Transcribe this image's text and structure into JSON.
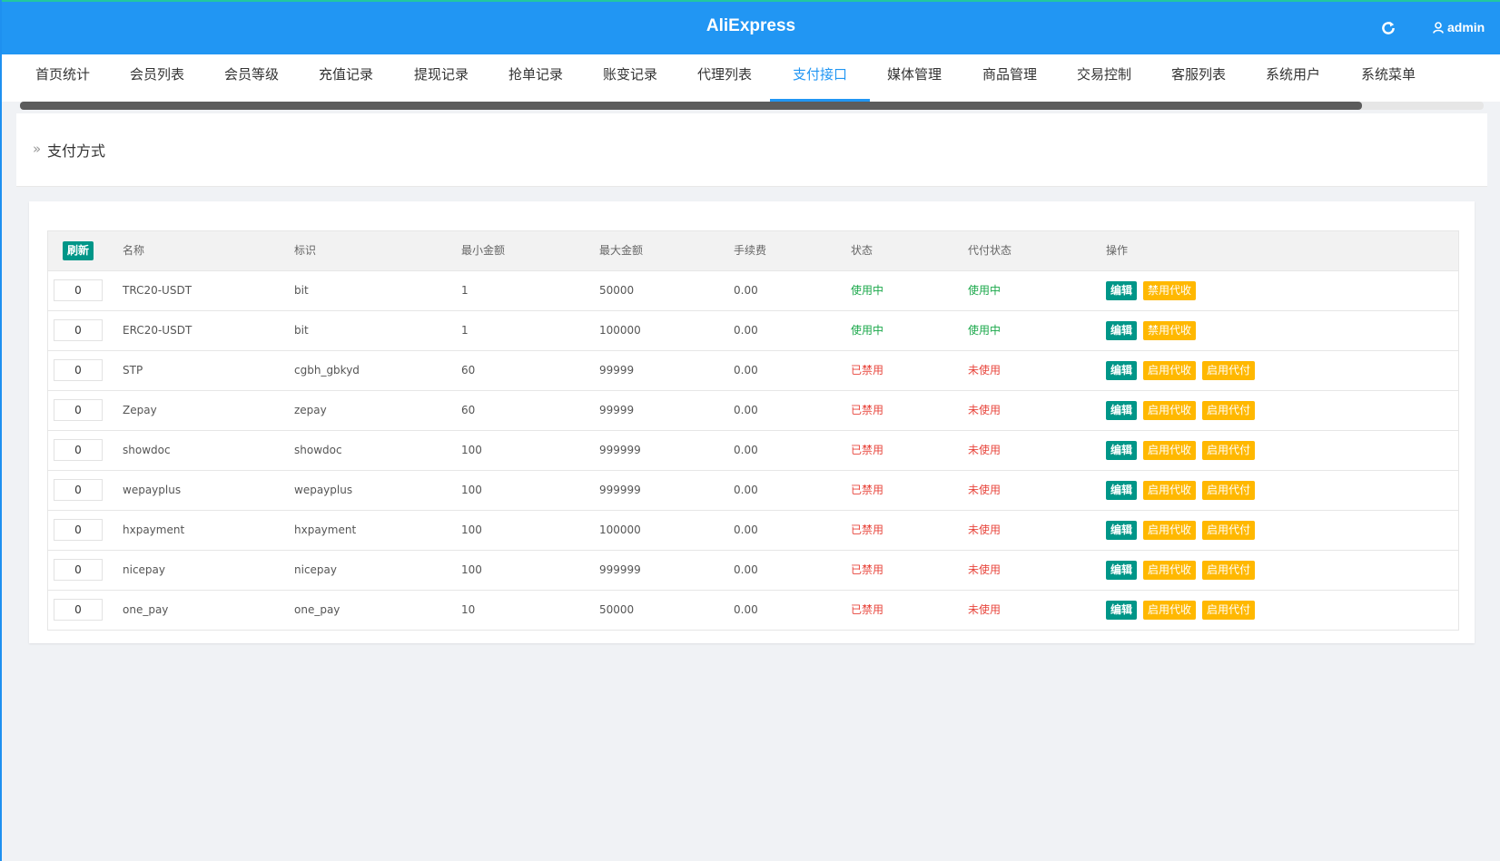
{
  "header": {
    "brand": "AliExpress",
    "user": "admin"
  },
  "nav": [
    {
      "label": "首页统计"
    },
    {
      "label": "会员列表"
    },
    {
      "label": "会员等级"
    },
    {
      "label": "充值记录"
    },
    {
      "label": "提现记录"
    },
    {
      "label": "抢单记录"
    },
    {
      "label": "账变记录"
    },
    {
      "label": "代理列表"
    },
    {
      "label": "支付接口",
      "active": true
    },
    {
      "label": "媒体管理"
    },
    {
      "label": "商品管理"
    },
    {
      "label": "交易控制"
    },
    {
      "label": "客服列表"
    },
    {
      "label": "系统用户"
    },
    {
      "label": "系统菜单"
    }
  ],
  "breadcrumb": {
    "title": "支付方式"
  },
  "table": {
    "refresh_label": "刷新",
    "headers": {
      "name": "名称",
      "ident": "标识",
      "min": "最小金额",
      "max": "最大金额",
      "fee": "手续费",
      "status": "状态",
      "payout": "代付状态",
      "ops": "操作"
    },
    "rows": [
      {
        "sort": "0",
        "name": "TRC20-USDT",
        "ident": "bit",
        "min": "1",
        "max": "50000",
        "fee": "0.00",
        "status": "使用中",
        "payout": "使用中",
        "enabled": true,
        "actions": [
          "编辑",
          "禁用代收"
        ]
      },
      {
        "sort": "0",
        "name": "ERC20-USDT",
        "ident": "bit",
        "min": "1",
        "max": "100000",
        "fee": "0.00",
        "status": "使用中",
        "payout": "使用中",
        "enabled": true,
        "actions": [
          "编辑",
          "禁用代收"
        ]
      },
      {
        "sort": "0",
        "name": "STP",
        "ident": "cgbh_gbkyd",
        "min": "60",
        "max": "99999",
        "fee": "0.00",
        "status": "已禁用",
        "payout": "未使用",
        "enabled": false,
        "actions": [
          "编辑",
          "启用代收",
          "启用代付"
        ]
      },
      {
        "sort": "0",
        "name": "Zepay",
        "ident": "zepay",
        "min": "60",
        "max": "99999",
        "fee": "0.00",
        "status": "已禁用",
        "payout": "未使用",
        "enabled": false,
        "actions": [
          "编辑",
          "启用代收",
          "启用代付"
        ]
      },
      {
        "sort": "0",
        "name": "showdoc",
        "ident": "showdoc",
        "min": "100",
        "max": "999999",
        "fee": "0.00",
        "status": "已禁用",
        "payout": "未使用",
        "enabled": false,
        "actions": [
          "编辑",
          "启用代收",
          "启用代付"
        ]
      },
      {
        "sort": "0",
        "name": "wepayplus",
        "ident": "wepayplus",
        "min": "100",
        "max": "999999",
        "fee": "0.00",
        "status": "已禁用",
        "payout": "未使用",
        "enabled": false,
        "actions": [
          "编辑",
          "启用代收",
          "启用代付"
        ]
      },
      {
        "sort": "0",
        "name": "hxpayment",
        "ident": "hxpayment",
        "min": "100",
        "max": "100000",
        "fee": "0.00",
        "status": "已禁用",
        "payout": "未使用",
        "enabled": false,
        "actions": [
          "编辑",
          "启用代收",
          "启用代付"
        ]
      },
      {
        "sort": "0",
        "name": "nicepay",
        "ident": "nicepay",
        "min": "100",
        "max": "999999",
        "fee": "0.00",
        "status": "已禁用",
        "payout": "未使用",
        "enabled": false,
        "actions": [
          "编辑",
          "启用代收",
          "启用代付"
        ]
      },
      {
        "sort": "0",
        "name": "one_pay",
        "ident": "one_pay",
        "min": "10",
        "max": "50000",
        "fee": "0.00",
        "status": "已禁用",
        "payout": "未使用",
        "enabled": false,
        "actions": [
          "编辑",
          "启用代收",
          "启用代付"
        ]
      }
    ]
  },
  "colors": {
    "primary": "#2196f3",
    "teal": "#009688",
    "orange": "#ffb800",
    "green": "#1aa84a",
    "red": "#e8453c"
  },
  "icons": {
    "refresh": "refresh-icon",
    "user": "user-icon"
  }
}
